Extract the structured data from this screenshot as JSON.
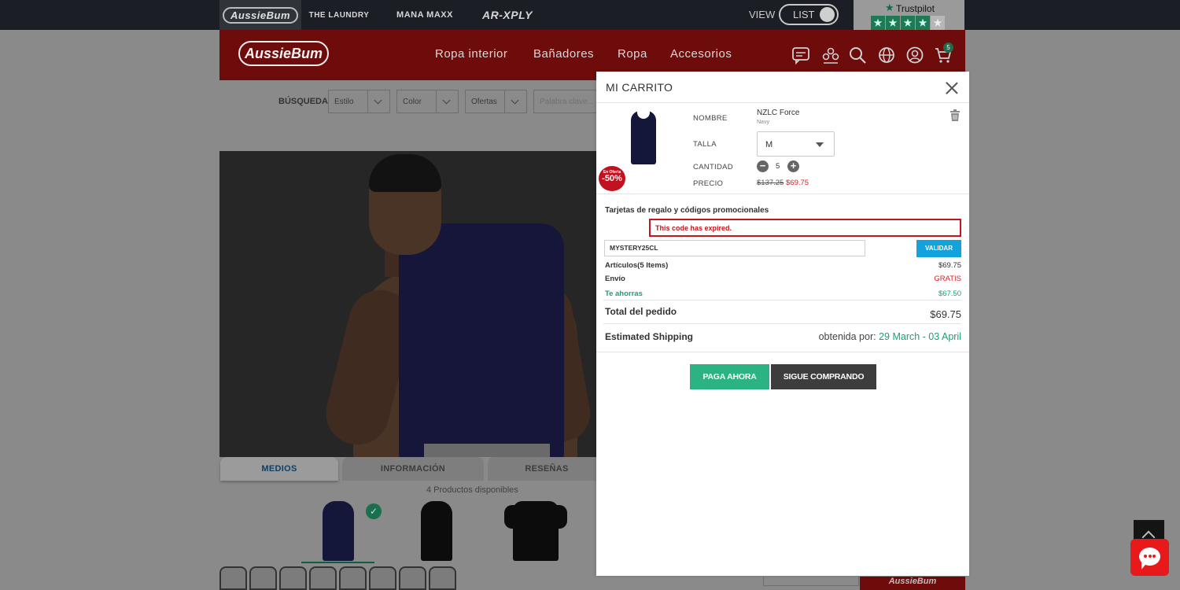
{
  "topbar": {
    "brands": [
      "AussieBum",
      "THE LAUNDRY",
      "MANA MAXX",
      "AR-XPLY"
    ],
    "view_label": "VIEW",
    "view_toggle": "LIST",
    "trustpilot_name": "Trustpilot",
    "trustpilot_stars": 4
  },
  "header": {
    "logo": "AussieBum",
    "nav": [
      "Ropa interior",
      "Bañadores",
      "Ropa",
      "Accesorios"
    ],
    "cart_count": "5"
  },
  "search": {
    "label": "BÚSQUEDA",
    "filters": [
      "Estilo",
      "Color",
      "Ofertas"
    ],
    "keyword_placeholder": "Palabra clave..."
  },
  "product": {
    "tabs": [
      "MEDIOS",
      "INFORMACIÓN",
      "RESEÑAS"
    ],
    "available": "4 Productos disponibles"
  },
  "footer": {
    "logo": "AussieBum"
  },
  "cart": {
    "title": "MI CARRITO",
    "item": {
      "badge_top": "En Oferta",
      "badge_discount": "-50%",
      "name_label": "NOMBRE",
      "name": "NZLC Force",
      "color": "Navy",
      "size_label": "TALLA",
      "size": "M",
      "qty_label": "CANTIDAD",
      "qty": "5",
      "price_label": "PRECIO",
      "price_old": "$137.25",
      "price_new": "$69.75"
    },
    "promo": {
      "title": "Tarjetas de regalo y códigos promocionales",
      "error": "This code has expired.",
      "code": "MYSTERY25CL",
      "validate_label": "VALIDAR"
    },
    "summary": {
      "items_label": "Artículos(5 Items)",
      "items_value": "$69.75",
      "shipping_label": "Envío",
      "shipping_value": "GRATIS",
      "savings_label": "Te ahorras",
      "savings_value": "$67.50",
      "total_label": "Total del pedido",
      "total_value": "$69.75",
      "est_label": "Estimated Shipping",
      "est_prefix": "obtenida por:",
      "est_dates": "29 March - 03 April"
    },
    "pay_label": "PAGA AHORA",
    "continue_label": "SIGUE COMPRANDO"
  },
  "colors": {
    "brand_red": "#c4161c",
    "pay_green": "#2cb383",
    "validate_blue": "#13a3dc",
    "dark_button": "#3d3d3d"
  }
}
